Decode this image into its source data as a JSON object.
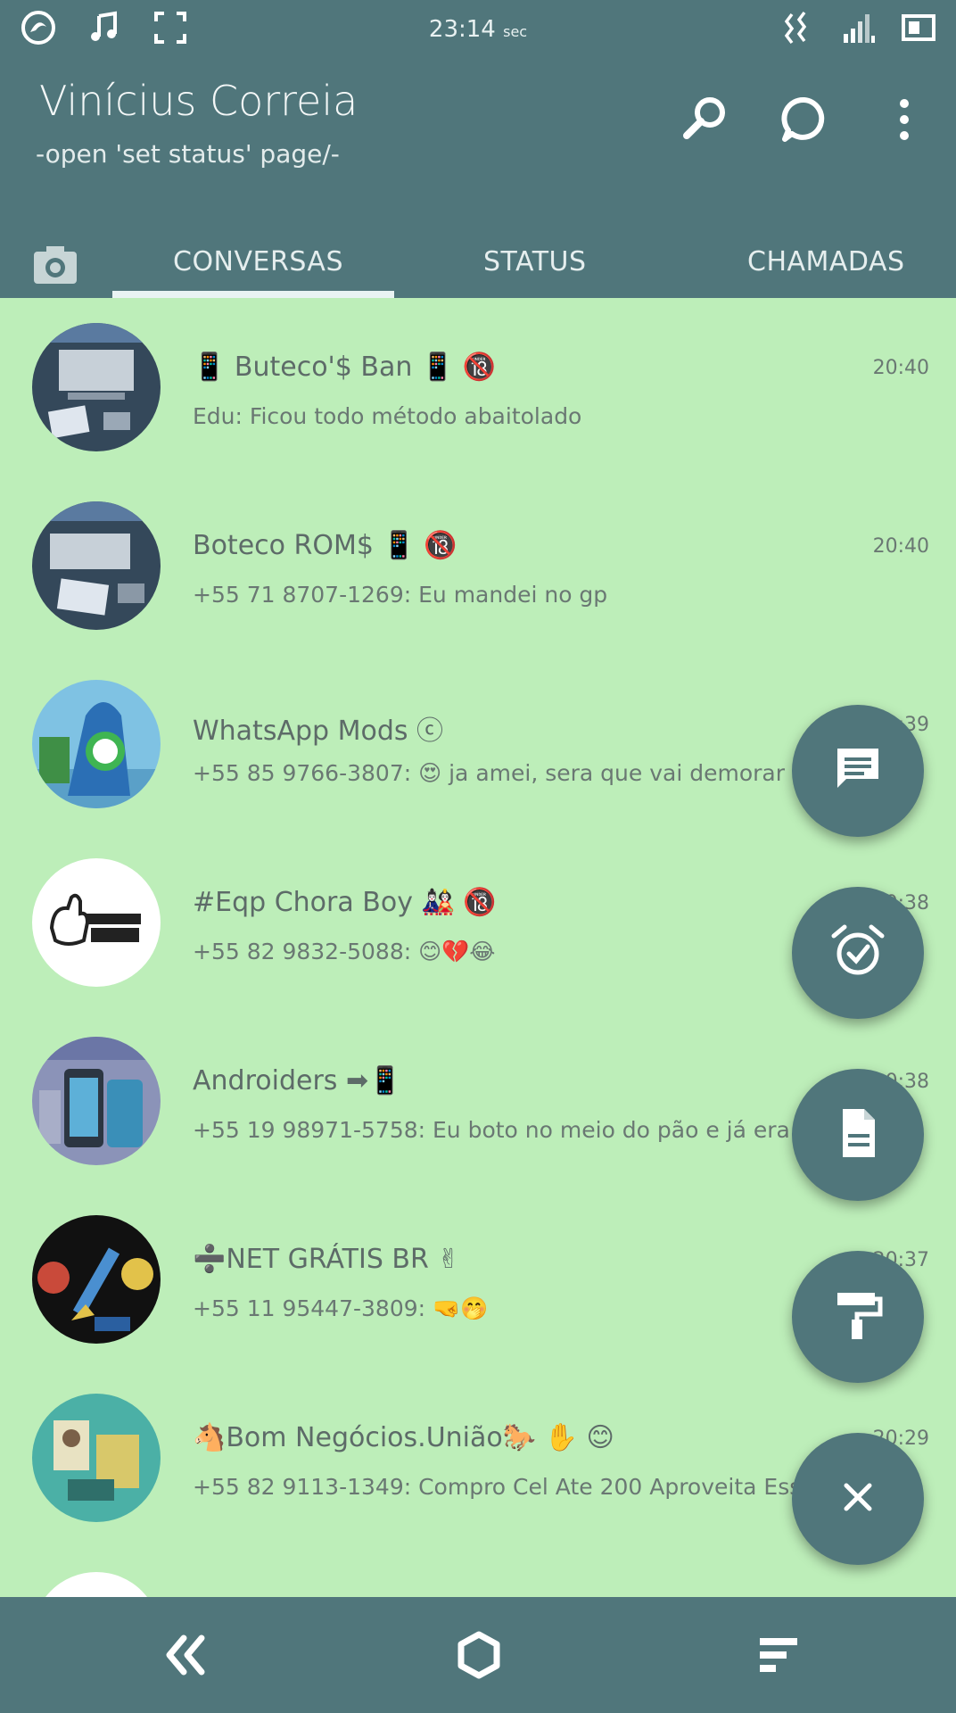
{
  "status_bar": {
    "time": "23:14",
    "time_suffix": "sec"
  },
  "header": {
    "title": "Vinícius Correia",
    "subtitle": "-open 'set status' page/-"
  },
  "tabs": [
    {
      "label": "CONVERSAS",
      "selected": true
    },
    {
      "label": "STATUS",
      "selected": false
    },
    {
      "label": "CHAMADAS",
      "selected": false
    }
  ],
  "chats": [
    {
      "name": "📱 Buteco'$ Ban 📱 🔞",
      "last": "Edu: Ficou todo método abaitolado",
      "time": "20:40"
    },
    {
      "name": "Boteco ROM$ 📱 🔞",
      "last": "+55 71 8707-1269: Eu mandei no gp",
      "time": "20:40"
    },
    {
      "name": "WhatsApp Mods ⓒ",
      "last": "+55 85 9766-3807: 😍 ja amei, sera que vai demorar em",
      "time": "20:39"
    },
    {
      "name": "#Eqp Chora Boy 🎎 🔞",
      "last": "+55 82 9832-5088: 😊💔😂",
      "time": "20:38"
    },
    {
      "name": "Androiders ➡📱",
      "last": "+55 19 98971-5758: Eu boto no meio do pão e já era",
      "time": "20:38"
    },
    {
      "name": "➗NET GRÁTIS BR ✌",
      "last": "+55 11 95447-3809: 🤜🤭",
      "time": "20:37"
    },
    {
      "name": "🐴Bom Negócios.União🐎 ✋ 😊",
      "last": "+55 82 9113-1349: Compro Cel Ate 200 Aproveita Essa Opor",
      "time": "20:29"
    }
  ],
  "colors": {
    "primary": "#50767b",
    "list_background": "#bdeeb9",
    "text_primary": "#5d6b68"
  },
  "fab_icons": [
    "message-icon",
    "alarm-check-icon",
    "document-icon",
    "paint-roller-icon",
    "close-icon"
  ]
}
